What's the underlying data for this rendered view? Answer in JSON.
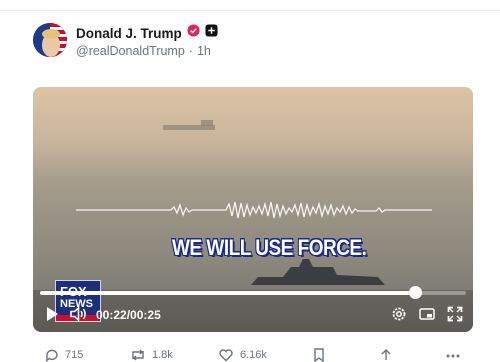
{
  "post": {
    "author_name": "Donald J. Trump",
    "handle": "@realDonaldTrump",
    "separator": "·",
    "time": "1h"
  },
  "video": {
    "caption": "WE WILL USE FORCE.",
    "current_time": "00:22",
    "duration": "00:25",
    "progress": 0.88,
    "logo_line1": "FOX",
    "logo_line2": "NEWS"
  },
  "actions": {
    "replies": "715",
    "reposts": "1.8k",
    "likes": "6.16k"
  },
  "colors": {
    "verified": "#e0245e",
    "sky_top": "#d9c2a6",
    "sea": "#8d8a7f"
  }
}
